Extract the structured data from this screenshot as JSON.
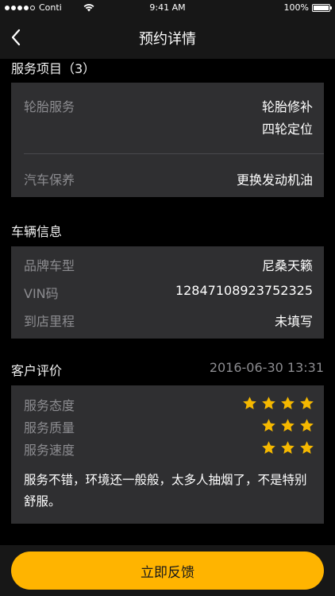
{
  "status_bar": {
    "carrier": "Conti",
    "time": "9:41 AM",
    "battery": "100%",
    "battery_level": 1.0
  },
  "nav": {
    "title": "预约详情",
    "back_icon": "chevron-left-icon"
  },
  "services": {
    "title": "服务项目（3）",
    "items": [
      {
        "label": "轮胎服务",
        "values": [
          "轮胎修补",
          "四轮定位"
        ]
      },
      {
        "label": "汽车保养",
        "values": [
          "更换发动机油"
        ]
      }
    ]
  },
  "vehicle": {
    "title": "车辆信息",
    "rows": [
      {
        "label": "品牌车型",
        "value": "尼桑天籁"
      },
      {
        "label": "VIN码",
        "value": "12847108923752325"
      },
      {
        "label": "到店里程",
        "value": "未填写"
      }
    ]
  },
  "review": {
    "title": "客户评价",
    "date": "2016-06-30 13:31",
    "ratings": [
      {
        "label": "服务态度",
        "stars": 4
      },
      {
        "label": "服务质量",
        "stars": 3
      },
      {
        "label": "服务速度",
        "stars": 3
      }
    ],
    "comment": "服务不错，环境还一般般，太多人抽烟了，不是特别舒服。"
  },
  "colors": {
    "accent": "#ffb400",
    "card_bg": "#2f2f31",
    "star": "#f5b800",
    "muted_text": "#8c8c90"
  },
  "feedback_button": {
    "label": "立即反馈"
  }
}
